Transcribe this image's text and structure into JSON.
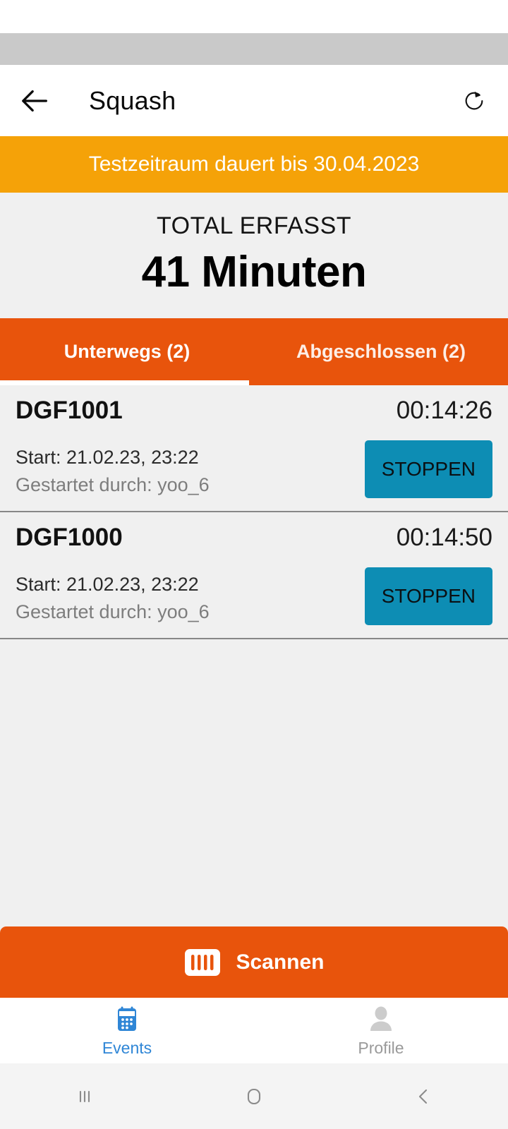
{
  "appbar": {
    "back_icon": "arrow-left-icon",
    "title": "Squash",
    "refresh_icon": "refresh-icon"
  },
  "banner": {
    "text": "Testzeitraum dauert bis 30.04.2023",
    "background": "#f5a208"
  },
  "total": {
    "label": "TOTAL ERFASST",
    "value": "41 Minuten"
  },
  "tabs": {
    "accent": "#e8540c",
    "items": [
      {
        "label": "Unterwegs (2)",
        "active": true
      },
      {
        "label": "Abgeschlossen (2)",
        "active": false
      }
    ]
  },
  "list": {
    "rows": [
      {
        "code": "DGF1001",
        "time": "00:14:26",
        "start": "Start: 21.02.23, 23:22",
        "started_by": "Gestartet durch: yoo_6",
        "action_label": "STOPPEN"
      },
      {
        "code": "DGF1000",
        "time": "00:14:50",
        "start": "Start: 21.02.23, 23:22",
        "started_by": "Gestartet durch: yoo_6",
        "action_label": "STOPPEN"
      }
    ]
  },
  "scan": {
    "label": "Scannen",
    "icon": "barcode-icon",
    "background": "#e8540c"
  },
  "bottomnav": {
    "items": [
      {
        "label": "Events",
        "icon": "calendar-icon",
        "active": true,
        "color": "#2f86d6"
      },
      {
        "label": "Profile",
        "icon": "person-icon",
        "active": false,
        "color": "#9a9a9a"
      }
    ]
  },
  "sysnav": {
    "recents_icon": "recents-icon",
    "home_icon": "home-icon",
    "back_icon": "back-chevron-icon"
  }
}
